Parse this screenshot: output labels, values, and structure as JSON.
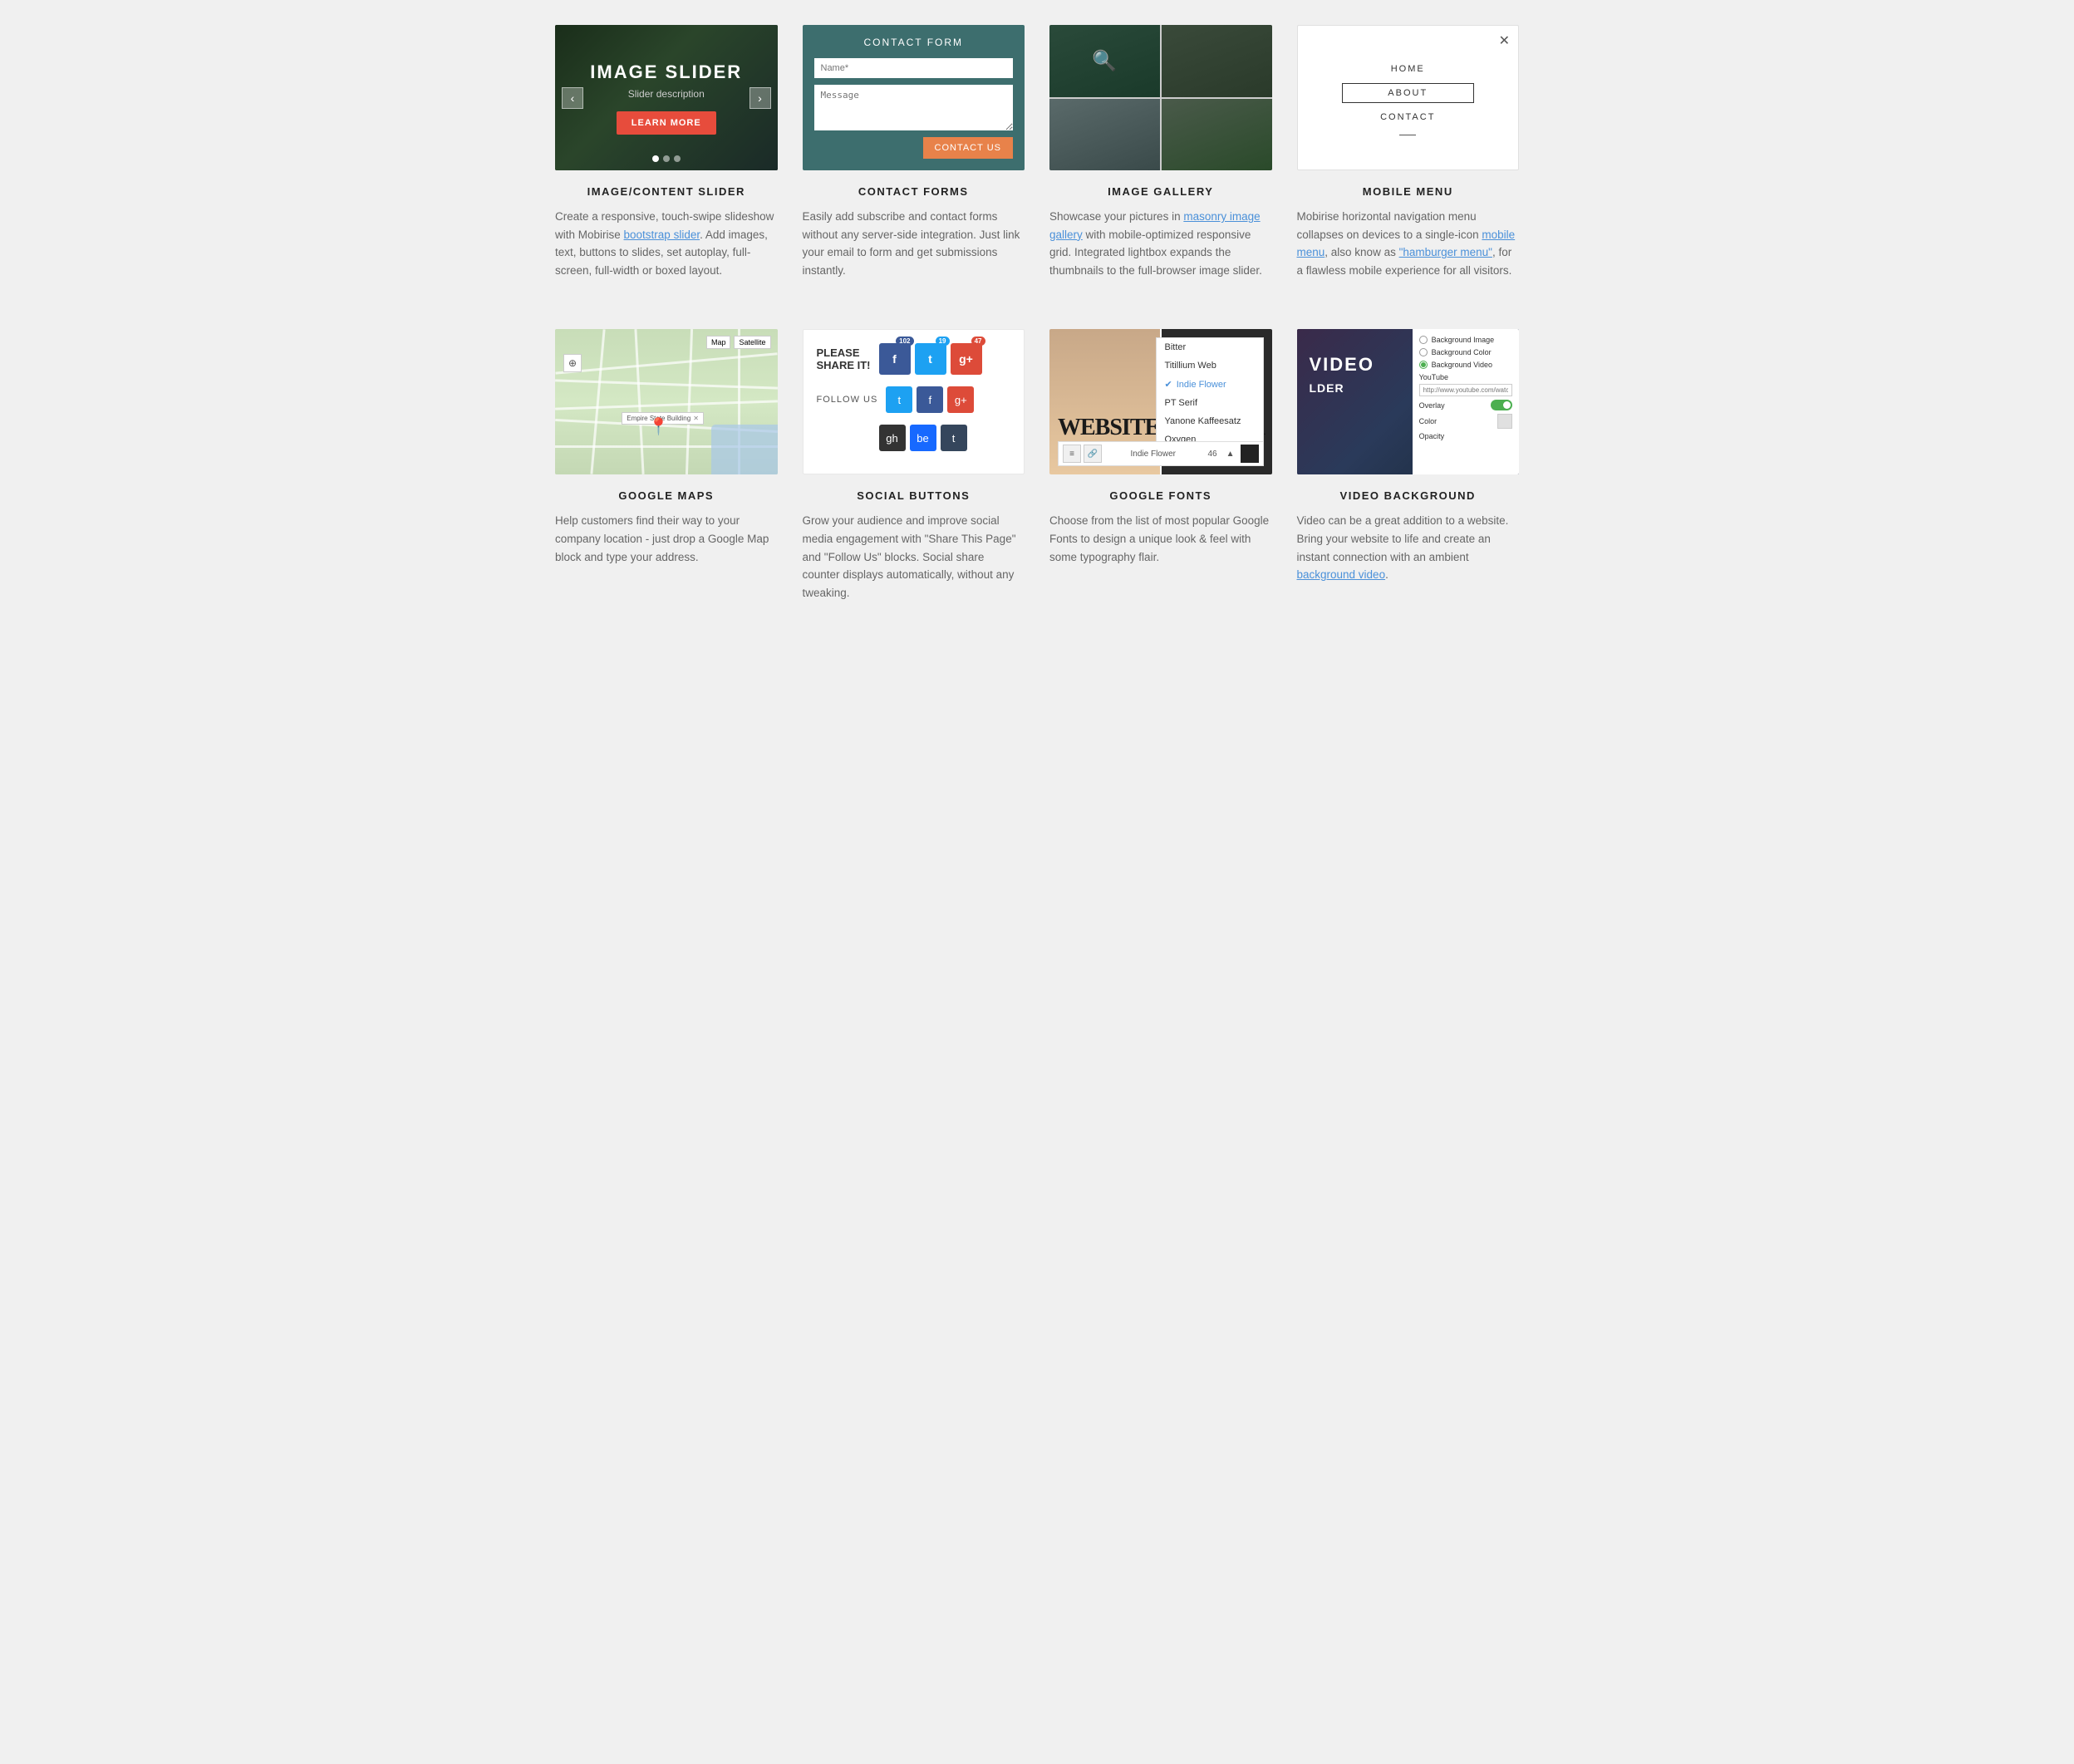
{
  "row1": {
    "cards": [
      {
        "id": "image-slider",
        "title": "IMAGE/CONTENT SLIDER",
        "desc": "Create a responsive, touch-swipe slideshow with Mobirise ",
        "link1": "bootstrap slider",
        "desc2": ". Add images, text, buttons to slides, set autoplay, full-screen, full-width or boxed layout.",
        "preview": {
          "heading": "IMAGE SLIDER",
          "subheading": "Slider description",
          "btn": "LEARN MORE",
          "dots": 3
        }
      },
      {
        "id": "contact-forms",
        "title": "CONTACT FORMS",
        "desc": "Easily add subscribe and contact forms without any server-side integration. Just link your email to form and get submissions instantly.",
        "preview": {
          "title": "CONTACT FORM",
          "namePlaceholder": "Name*",
          "messagePlaceholder": "Message",
          "btnLabel": "CONTACT US"
        }
      },
      {
        "id": "image-gallery",
        "title": "IMAGE GALLERY",
        "desc": "Showcase your pictures in ",
        "link1": "masonry image gallery",
        "desc2": " with mobile-optimized responsive grid. Integrated lightbox expands the thumbnails to the full-browser image slider."
      },
      {
        "id": "mobile-menu",
        "title": "MOBILE MENU",
        "desc": "Mobirise horizontal navigation menu collapses on devices to a single-icon ",
        "link1": "mobile menu",
        "desc2": ", also know as ",
        "link2": "\"hamburger menu\"",
        "desc3": ", for a flawless mobile experience for all visitors.",
        "preview": {
          "items": [
            "HOME",
            "ABOUT",
            "CONTACT"
          ]
        }
      }
    ]
  },
  "row2": {
    "cards": [
      {
        "id": "google-maps",
        "title": "GOOGLE MAPS",
        "desc": "Help customers find their way to your company location - just drop a Google Map block and type your address.",
        "preview": {
          "mapBtn1": "Map",
          "mapBtn2": "Satellite",
          "locationLabel": "Empire State Building",
          "controls": "⊕"
        }
      },
      {
        "id": "social-buttons",
        "title": "SOCIAL BUTTONS",
        "desc": "Grow your audience and improve social media engagement with \"Share This Page\" and \"Follow Us\" blocks. Social share counter displays automatically, without any tweaking.",
        "preview": {
          "shareLabel": "PLEASE\nSHARE IT!",
          "followLabel": "FOLLOW US",
          "fbCount": "102",
          "twCount": "19",
          "gpCount": "47"
        }
      },
      {
        "id": "google-fonts",
        "title": "GOOGLE FONTS",
        "desc": "Choose from the list of most popular Google Fonts to design a unique look & feel with some typography flair.",
        "preview": {
          "fonts": [
            "Bitter",
            "Titillium Web",
            "Indie Flower",
            "PT Serif",
            "Yanone Kaffeesatz",
            "Oxygen"
          ],
          "activeFont": "Indie Flower",
          "bigText": "WEBSITE BUILDER",
          "size": "46"
        }
      },
      {
        "id": "video-background",
        "title": "VIDEO BACKGROUND",
        "desc": "Video can be a great addition to a website. Bring your website to life and create an instant connection with an ambient ",
        "link1": "background video",
        "desc2": ".",
        "preview": {
          "videoText": "VIDEO",
          "options": [
            "Background Image",
            "Background Color",
            "Background Video"
          ],
          "activeOption": "Background Video",
          "ytLabel": "YouTube",
          "ytPlaceholder": "http://www.youtube.com/watch?",
          "overlayLabel": "Overlay",
          "colorLabel": "Color",
          "opacityLabel": "Opacity"
        }
      }
    ]
  }
}
